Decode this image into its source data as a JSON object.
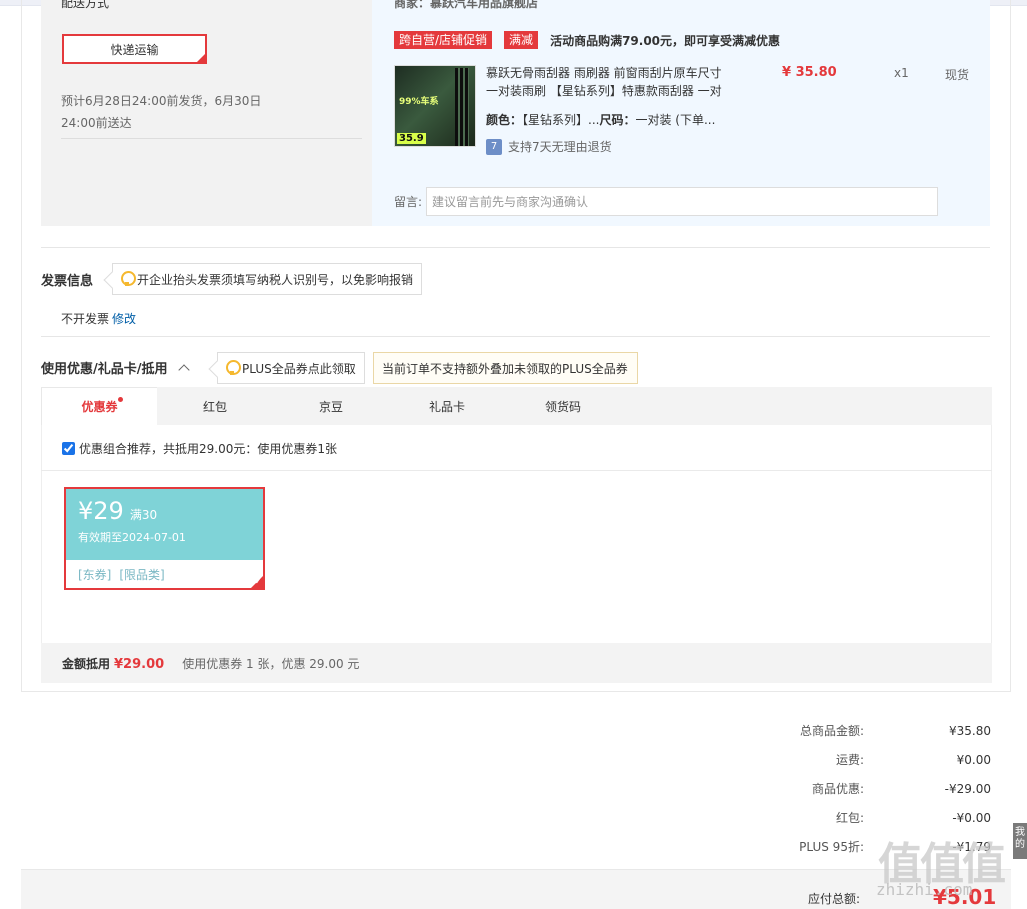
{
  "shipping": {
    "section_label": "配送方式",
    "method": "快递运输",
    "estimate": "预计6月28日24:00前发货，6月30日24:00前送达"
  },
  "seller": {
    "label": "商家：慕跃汽车用品旗舰店"
  },
  "promo": {
    "tag1": "跨自营/店铺促销",
    "tag2": "满减",
    "text": "活动商品购满79.00元，即可享受满减优惠"
  },
  "product": {
    "image_badge": "99%车系",
    "image_price": "35.9",
    "name": "慕跃无骨雨刮器 雨刷器 前窗雨刮片原车尺寸一对装雨刷 【星钻系列】特惠款雨刮器 一对",
    "price": "¥ 35.80",
    "qty": "x1",
    "stock": "现货",
    "attr_color_label": "颜色：",
    "attr_color": "【星钻系列】...",
    "attr_size_label": "尺码：",
    "attr_size": "一对装 (下单...",
    "return_icon": "7",
    "return_text": "支持7天无理由退货"
  },
  "message": {
    "label": "留言:",
    "placeholder": "建议留言前先与商家沟通确认"
  },
  "invoice": {
    "title": "发票信息",
    "tip": "开企业抬头发票须填写纳税人识别号，以免影响报销",
    "value": "不开发票",
    "edit": "修改"
  },
  "coupons": {
    "title": "使用优惠/礼品卡/抵用",
    "tip1": "PLUS全品券点此领取",
    "tip2": "当前订单不支持额外叠加未领取的PLUS全品券",
    "tabs": [
      {
        "label": "优惠券"
      },
      {
        "label": "红包"
      },
      {
        "label": "京豆"
      },
      {
        "label": "礼品卡"
      },
      {
        "label": "领货码"
      }
    ],
    "combo_text": "优惠组合推荐，共抵用29.00元：使用优惠券1张",
    "card": {
      "amount": "¥29",
      "condition": "满30",
      "valid": "有效期至2024-07-01",
      "tag1": "[东券]",
      "tag2": "[限品类]"
    },
    "summary_label": "金额抵用",
    "summary_amount": "¥29.00",
    "summary_text": "使用优惠券 1 张，优惠 29.00 元"
  },
  "totals": {
    "rows": [
      {
        "label": "总商品金额:",
        "value": "¥35.80"
      },
      {
        "label": "运费:",
        "value": "¥0.00"
      },
      {
        "label": "商品优惠:",
        "value": "-¥29.00"
      },
      {
        "label": "红包:",
        "value": "-¥0.00"
      },
      {
        "label": "PLUS 95折:",
        "value": "-¥1.79"
      }
    ],
    "payable_label": "应付总额:",
    "payable_value": "¥5.01"
  },
  "side_tab": "我的",
  "watermark": {
    "logo": "值值值",
    "url": "zhizhi.com"
  },
  "colors": {
    "accent": "#e4393c",
    "link": "#005ea7",
    "coupon_bg": "#7fd3d7"
  }
}
